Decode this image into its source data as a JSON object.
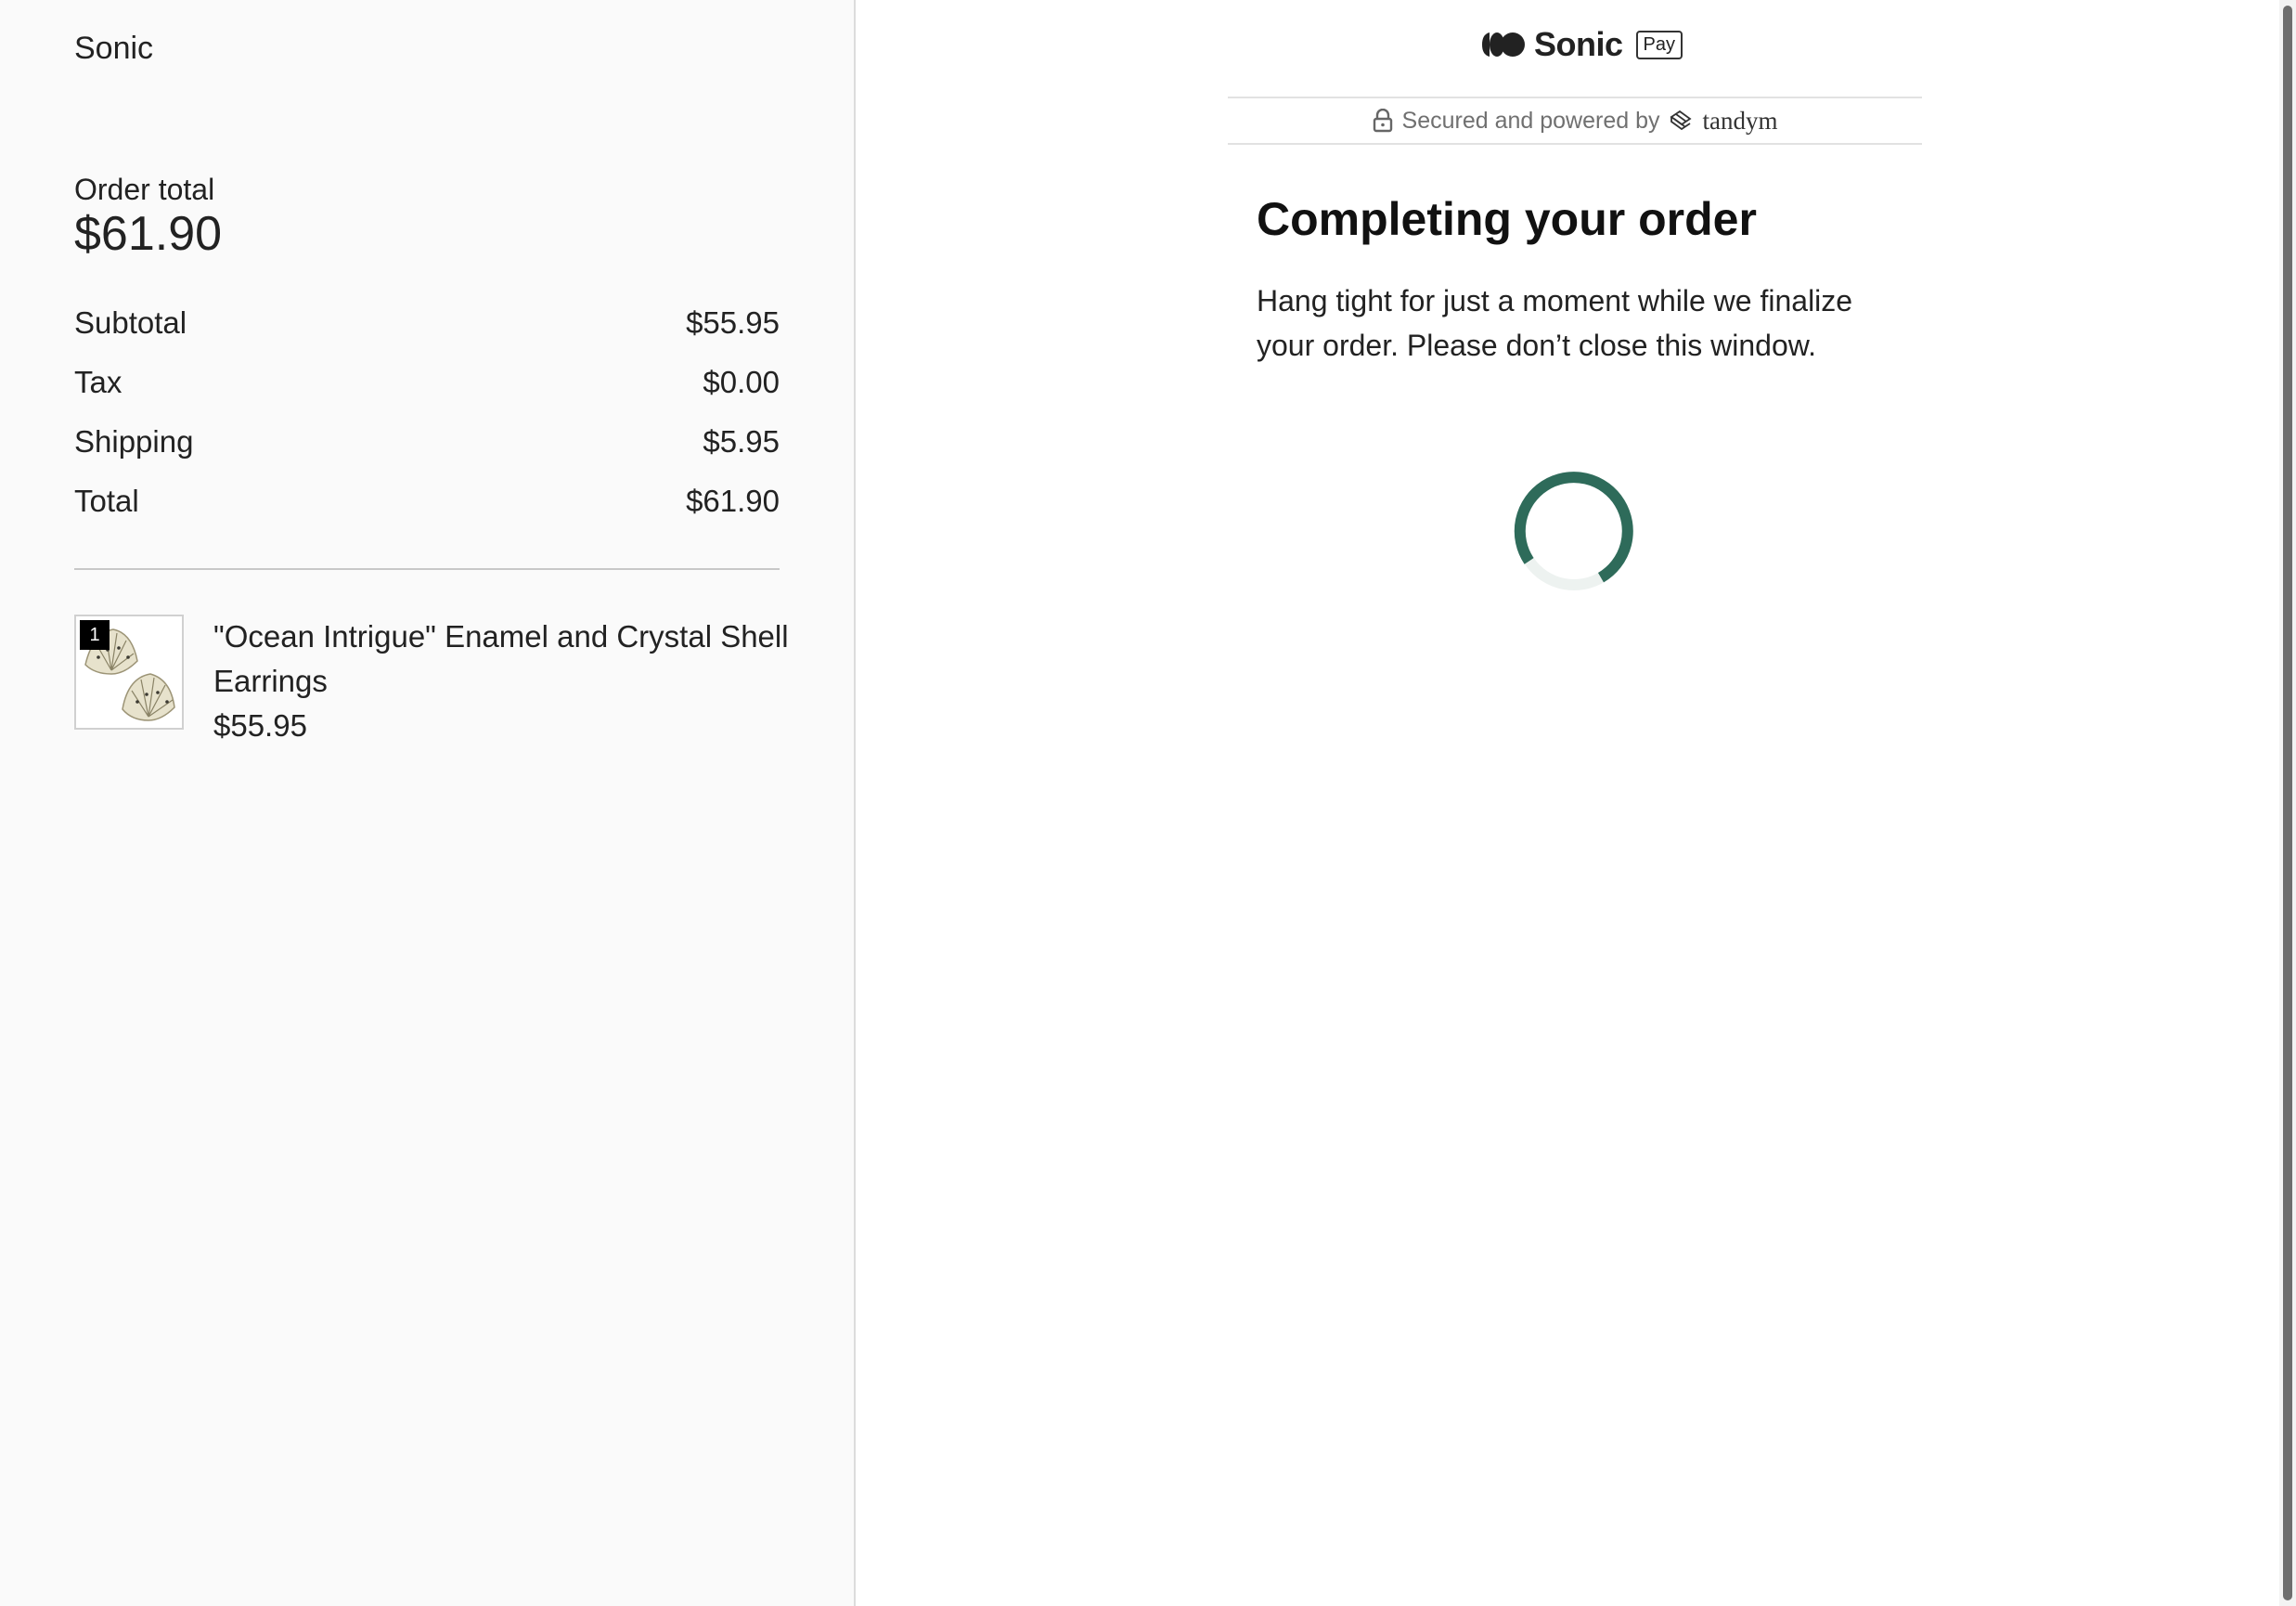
{
  "store": {
    "name": "Sonic"
  },
  "order": {
    "total_label": "Order total",
    "total_value": "$61.90",
    "summary": [
      {
        "label": "Subtotal",
        "value": "$55.95"
      },
      {
        "label": "Tax",
        "value": "$0.00"
      },
      {
        "label": "Shipping",
        "value": "$5.95"
      },
      {
        "label": "Total",
        "value": "$61.90"
      }
    ]
  },
  "product": {
    "quantity": "1",
    "name": "\"Ocean Intrigue\" Enamel and Crystal Shell Earrings",
    "price": "$55.95",
    "image_icon": "shell-earrings-image"
  },
  "checkout": {
    "brand_name": "Sonic",
    "brand_badge": "Pay",
    "secure_text": "Secured and powered by",
    "provider": "tandym",
    "headline": "Completing your order",
    "message": "Hang tight for just a moment while we finalize your order. Please don’t close this window.",
    "spinner_color": "#2e6b5a"
  }
}
